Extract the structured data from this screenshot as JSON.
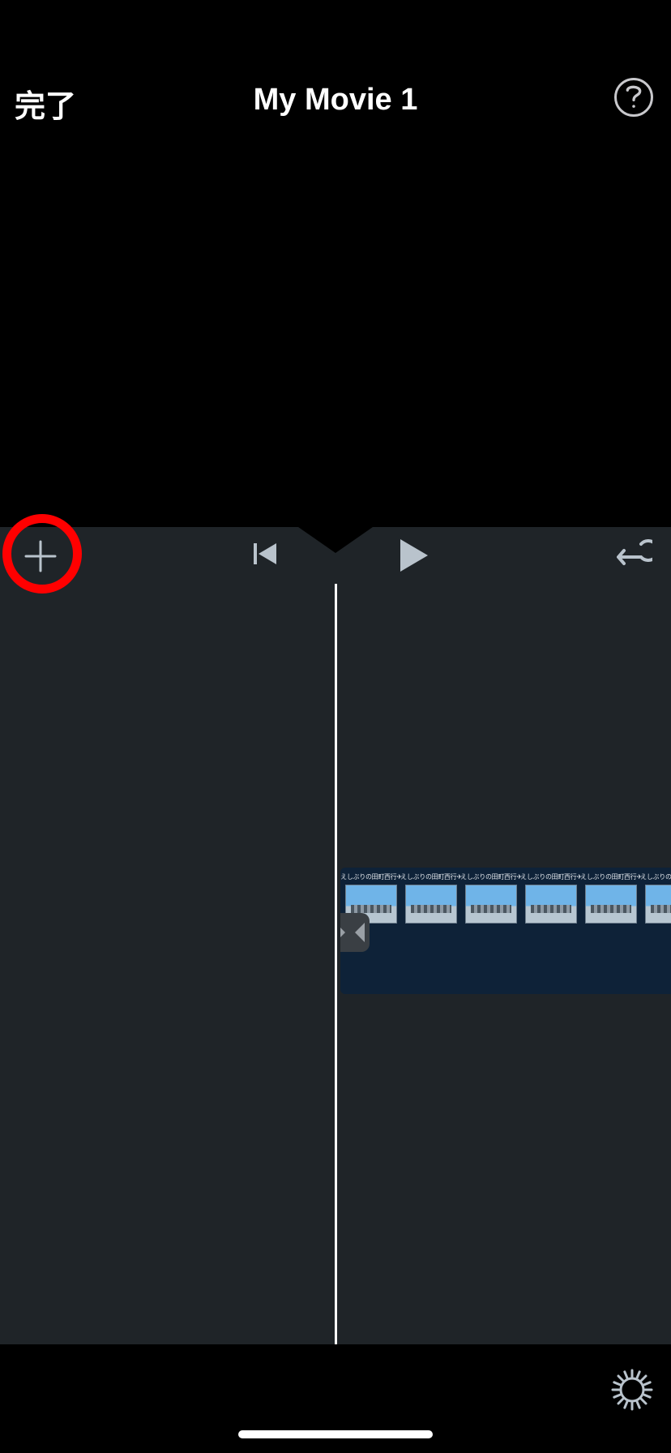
{
  "header": {
    "done_label": "完了",
    "title": "My Movie 1"
  },
  "icons": {
    "help": "help-icon",
    "add": "plus-icon",
    "skip_back": "skip-back-icon",
    "play": "play-icon",
    "undo": "undo-icon",
    "settings": "gear-icon"
  },
  "annotation": {
    "highlighted_control": "add-media-button"
  },
  "timeline": {
    "clip": {
      "thumbnail_label": "えしぶりの田町西行✈",
      "thumbnail_count": 6
    }
  }
}
